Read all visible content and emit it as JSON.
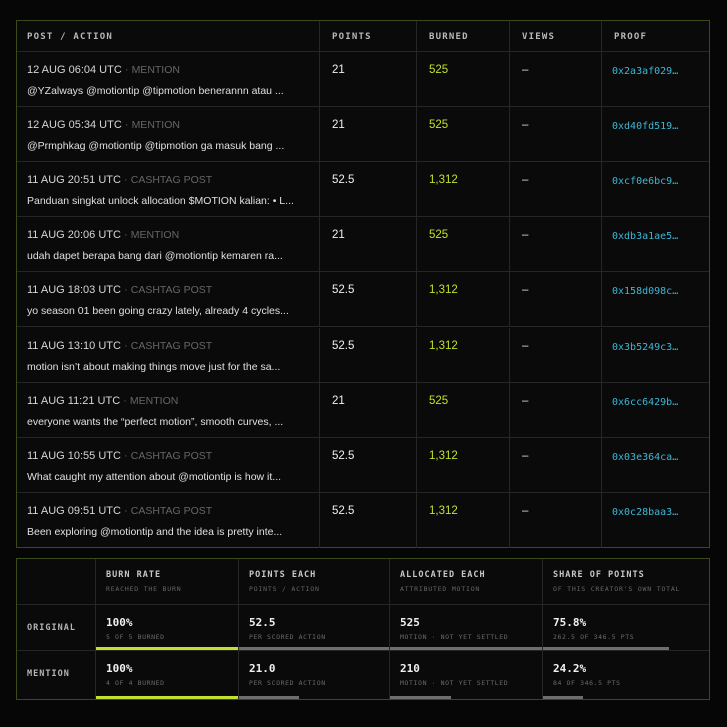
{
  "table": {
    "headers": [
      "POST / ACTION",
      "POINTS",
      "BURNED",
      "VIEWS",
      "PROOF"
    ],
    "rows": [
      {
        "time": "12 AUG 06:04 UTC",
        "kind": "MENTION",
        "text": "@YZalways @motiontip @tipmotion benerannn atau ...",
        "points": "21",
        "burned": "525",
        "views": "–",
        "proof": "0x2a3af029…"
      },
      {
        "time": "12 AUG 05:34 UTC",
        "kind": "MENTION",
        "text": "@Prmphkag @motiontip @tipmotion ga masuk bang ...",
        "points": "21",
        "burned": "525",
        "views": "–",
        "proof": "0xd40fd519…"
      },
      {
        "time": "11 AUG 20:51 UTC",
        "kind": "CASHTAG POST",
        "text": "Panduan singkat unlock allocation $MOTION kalian: • L...",
        "points": "52.5",
        "burned": "1,312",
        "views": "–",
        "proof": "0xcf0e6bc9…"
      },
      {
        "time": "11 AUG 20:06 UTC",
        "kind": "MENTION",
        "text": "udah dapet berapa bang dari @motiontip kemaren ra...",
        "points": "21",
        "burned": "525",
        "views": "–",
        "proof": "0xdb3a1ae5…"
      },
      {
        "time": "11 AUG 18:03 UTC",
        "kind": "CASHTAG POST",
        "text": "yo season 01 been going crazy lately, already 4 cycles...",
        "points": "52.5",
        "burned": "1,312",
        "views": "–",
        "proof": "0x158d098c…"
      },
      {
        "time": "11 AUG 13:10 UTC",
        "kind": "CASHTAG POST",
        "text": "motion isn’t about making things move just for the sa...",
        "points": "52.5",
        "burned": "1,312",
        "views": "–",
        "proof": "0x3b5249c3…"
      },
      {
        "time": "11 AUG 11:21 UTC",
        "kind": "MENTION",
        "text": "everyone wants the “perfect motion”, smooth curves, ...",
        "points": "21",
        "burned": "525",
        "views": "–",
        "proof": "0x6cc6429b…"
      },
      {
        "time": "11 AUG 10:55 UTC",
        "kind": "CASHTAG POST",
        "text": "What caught my attention about @motiontip is how it...",
        "points": "52.5",
        "burned": "1,312",
        "views": "–",
        "proof": "0x03e364ca…"
      },
      {
        "time": "11 AUG 09:51 UTC",
        "kind": "CASHTAG POST",
        "text": "Been exploring @motiontip and the idea is pretty inte...",
        "points": "52.5",
        "burned": "1,312",
        "views": "–",
        "proof": "0x0c28baa3…"
      }
    ]
  },
  "stats": {
    "columns": [
      {
        "title": "BURN RATE",
        "sub": "REACHED THE BURN"
      },
      {
        "title": "POINTS EACH",
        "sub": "POINTS / ACTION"
      },
      {
        "title": "ALLOCATED EACH",
        "sub": "ATTRIBUTED MOTION"
      },
      {
        "title": "SHARE OF POINTS",
        "sub": "OF THIS CREATOR'S OWN TOTAL"
      }
    ],
    "rows": [
      {
        "label": "ORIGINAL",
        "cells": [
          {
            "value": "100%",
            "sub": "5 of 5 burned",
            "fill": 1.0,
            "accent": true
          },
          {
            "value": "52.5",
            "sub": "per scored action",
            "fill": 1.0,
            "accent": false
          },
          {
            "value": "525",
            "sub": "motion · not yet settled",
            "fill": 1.0,
            "accent": false
          },
          {
            "value": "75.8%",
            "sub": "262.5 of 346.5 pts",
            "fill": 0.758,
            "accent": false
          }
        ]
      },
      {
        "label": "MENTION",
        "cells": [
          {
            "value": "100%",
            "sub": "4 of 4 burned",
            "fill": 1.0,
            "accent": true
          },
          {
            "value": "21.0",
            "sub": "per scored action",
            "fill": 0.4,
            "accent": false
          },
          {
            "value": "210",
            "sub": "motion · not yet settled",
            "fill": 0.4,
            "accent": false
          },
          {
            "value": "24.2%",
            "sub": "84 of 346.5 pts",
            "fill": 0.242,
            "accent": false
          }
        ]
      }
    ]
  },
  "colors": {
    "accent": "#c4e02a",
    "proof": "#3cb8d8",
    "border": "#3a4a18"
  }
}
